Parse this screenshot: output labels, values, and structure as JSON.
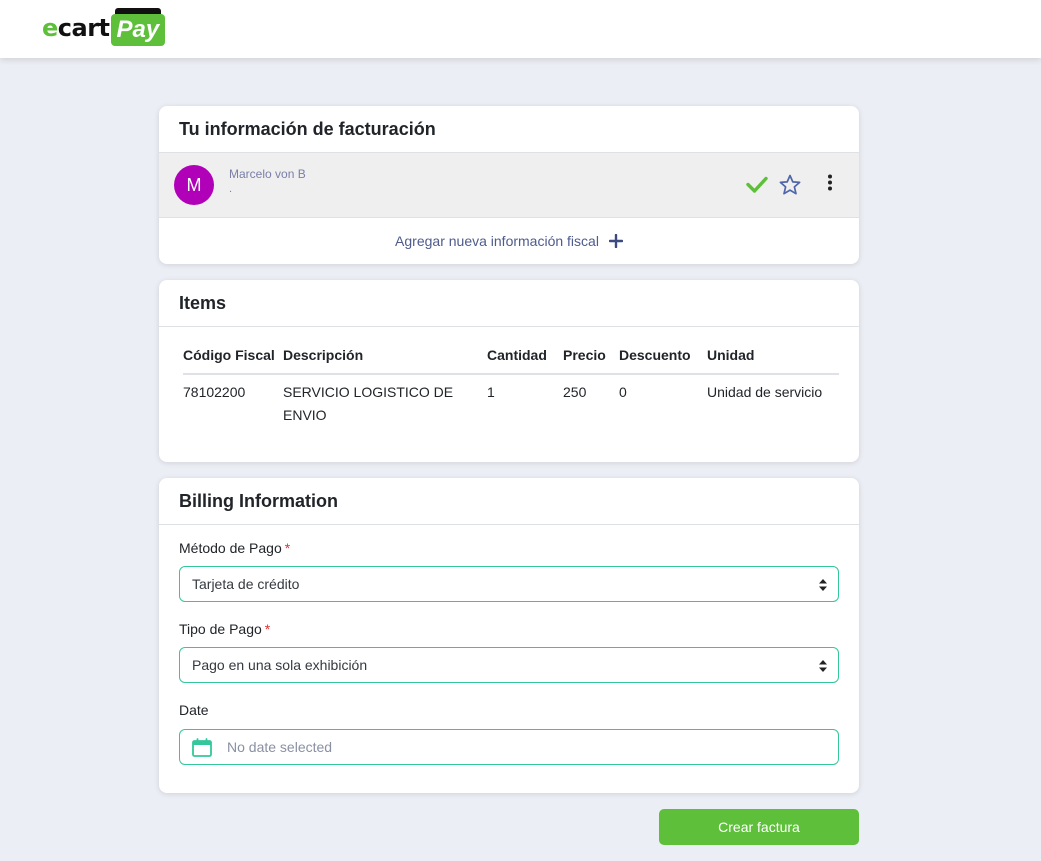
{
  "logo": {
    "part1": "e",
    "part2": "cart",
    "part3": "Pay"
  },
  "colors": {
    "brand_green": "#5dbf3a",
    "input_border": "#34c79b",
    "avatar": "#b000b8",
    "page_bg": "#eceef5"
  },
  "facturacion": {
    "title": "Tu información de facturación",
    "entry": {
      "avatar_letter": "M",
      "name": "Marcelo von B",
      "sub": "."
    },
    "add_label": "Agregar nueva información fiscal"
  },
  "items": {
    "title": "Items",
    "headers": [
      "Código Fiscal",
      "Descripción",
      "Cantidad",
      "Precio",
      "Descuento",
      "Unidad"
    ],
    "rows": [
      [
        "78102200",
        "SERVICIO LOGISTICO DE ENVIO",
        "1",
        "250",
        "0",
        "Unidad de servicio"
      ]
    ]
  },
  "billing": {
    "title": "Billing Information",
    "metodo_label": "Método de Pago",
    "metodo_value": "Tarjeta de crédito",
    "tipo_label": "Tipo de Pago",
    "tipo_value": "Pago en una sola exhibición",
    "required_mark": "*",
    "date_label": "Date",
    "date_placeholder": "No date selected"
  },
  "actions": {
    "create_label": "Crear factura"
  }
}
